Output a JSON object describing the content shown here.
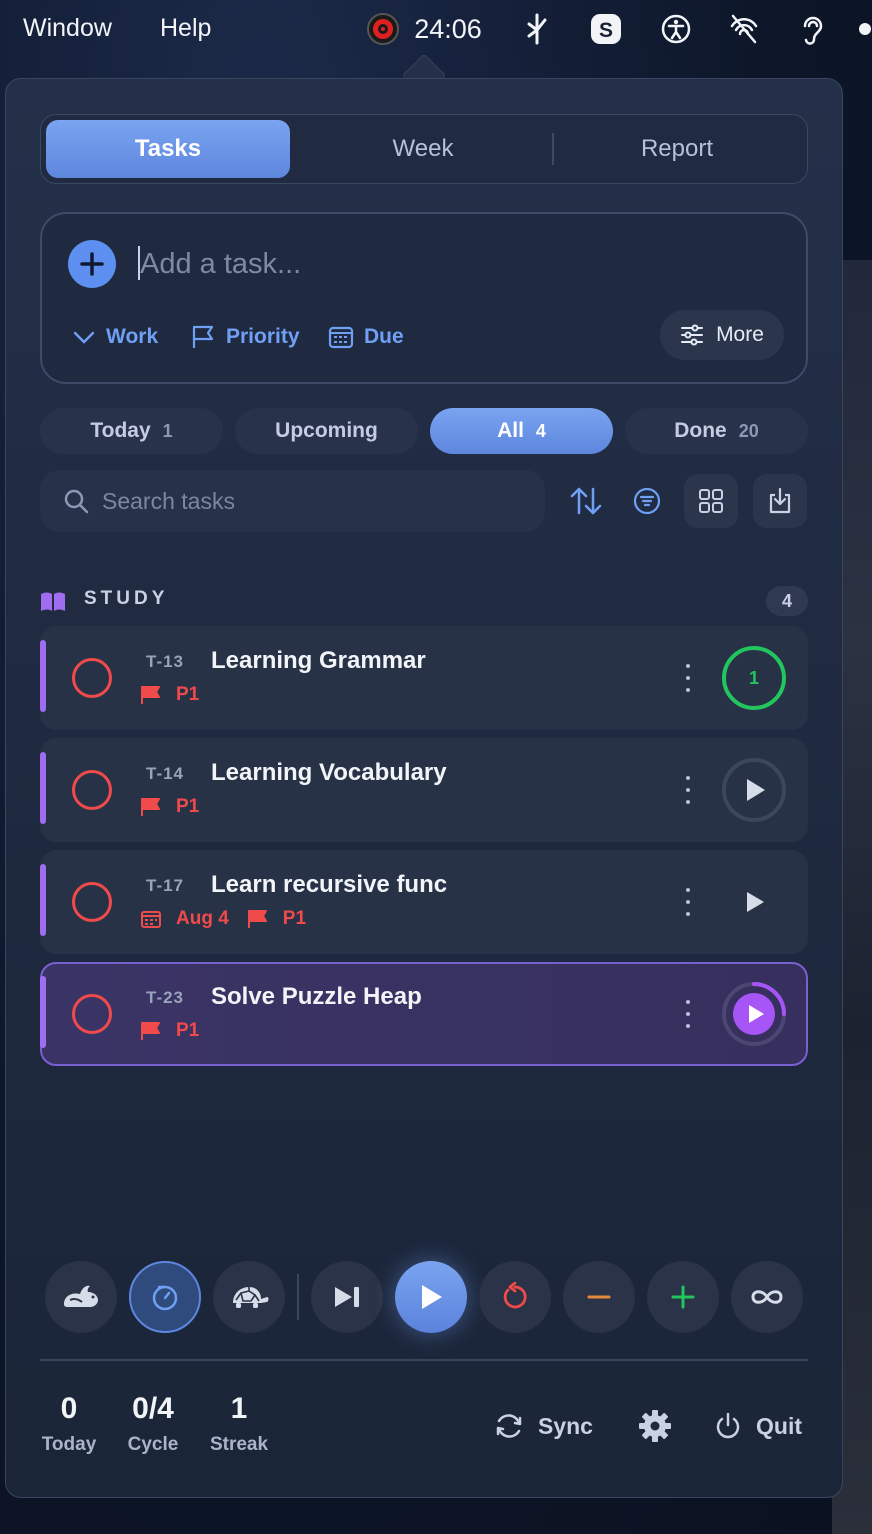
{
  "menubar": {
    "items": [
      "Window",
      "Help"
    ],
    "timer": "24:06",
    "tray_icons": [
      "pomodoro-icon",
      "bluetooth-like-icon",
      "skype-icon",
      "accessibility-icon",
      "airdrop-off-icon",
      "hearing-icon"
    ]
  },
  "tabs": [
    {
      "label": "Tasks",
      "active": true
    },
    {
      "label": "Week",
      "active": false
    },
    {
      "label": "Report",
      "active": false
    }
  ],
  "add_task": {
    "placeholder": "Add a task...",
    "project": "Work",
    "priority": "Priority",
    "due": "Due",
    "more": "More"
  },
  "filters": [
    {
      "label": "Today",
      "count": "1",
      "active": false
    },
    {
      "label": "Upcoming",
      "count": "",
      "active": false
    },
    {
      "label": "All",
      "count": "4",
      "active": true
    },
    {
      "label": "Done",
      "count": "20",
      "active": false
    }
  ],
  "search": {
    "placeholder": "Search tasks",
    "tools": [
      "sort-icon",
      "filter-icon",
      "grid-view-icon",
      "import-icon"
    ]
  },
  "section": {
    "title": "STUDY",
    "count": "4"
  },
  "tasks": [
    {
      "id": "T-13",
      "title": "Learning Grammar",
      "due": "",
      "priority": "P1",
      "action": "session-count",
      "action_value": "1"
    },
    {
      "id": "T-14",
      "title": "Learning Vocabulary",
      "due": "",
      "priority": "P1",
      "action": "play",
      "action_value": ""
    },
    {
      "id": "T-17",
      "title": "Learn recursive func",
      "due": "Aug 4",
      "priority": "P1",
      "action": "play",
      "action_value": ""
    },
    {
      "id": "T-23",
      "title": "Solve Puzzle Heap",
      "due": "",
      "priority": "P1",
      "action": "play-active",
      "action_value": ""
    }
  ],
  "controls": [
    "rabbit-icon",
    "timer-icon",
    "turtle-icon",
    "skip-icon",
    "play-icon",
    "reset-icon",
    "minus-icon",
    "plus-icon",
    "infinity-icon"
  ],
  "colors": {
    "accent": "#6fa0f5",
    "priority": "#f04a4a",
    "success": "#22c55e",
    "focus": "#a855f7"
  },
  "stats": [
    {
      "value": "0",
      "label": "Today"
    },
    {
      "value": "0/4",
      "label": "Cycle"
    },
    {
      "value": "1",
      "label": "Streak"
    }
  ],
  "footer": {
    "sync": "Sync",
    "quit": "Quit"
  }
}
